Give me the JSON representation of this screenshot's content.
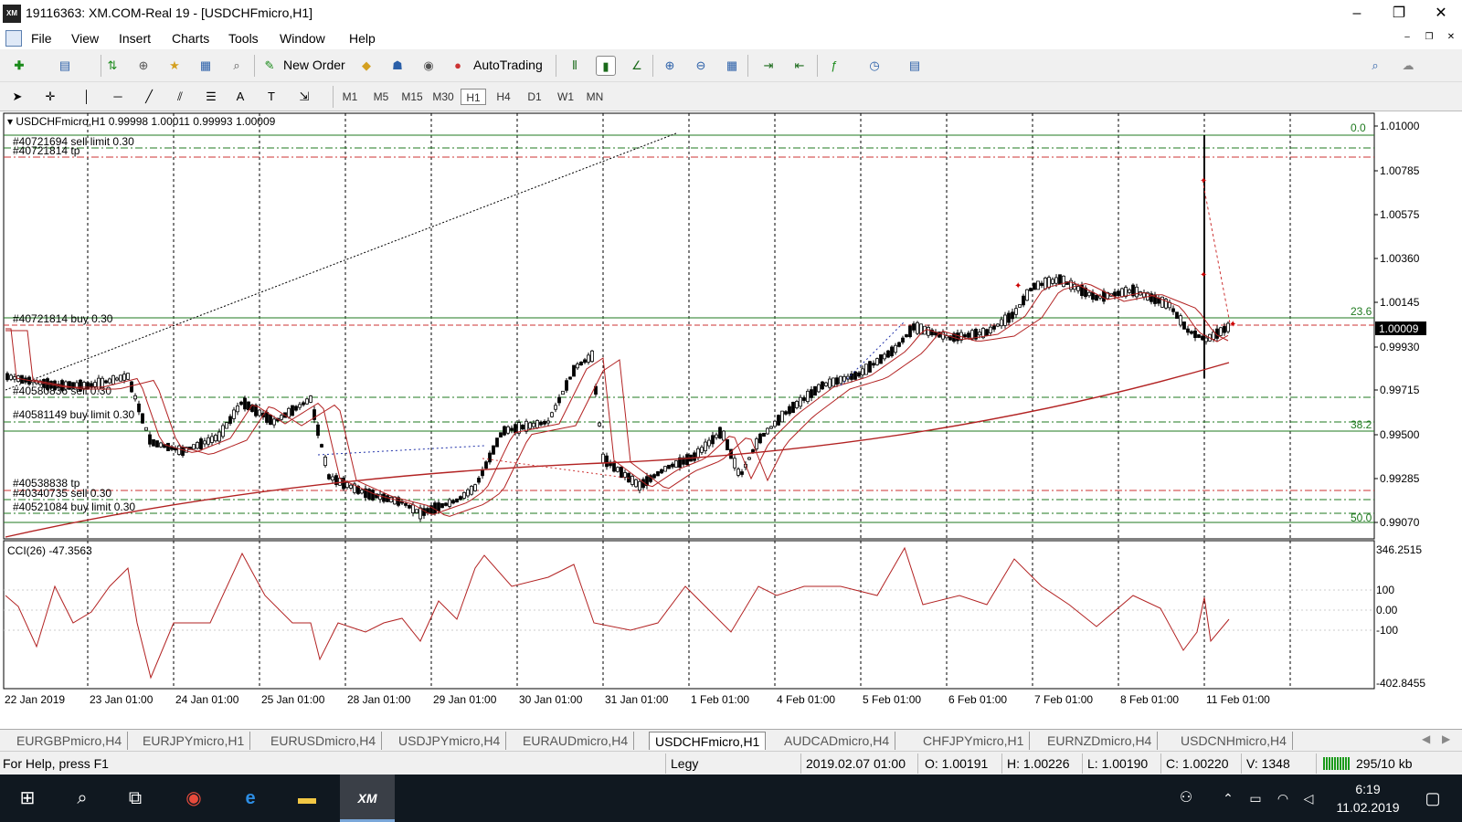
{
  "window": {
    "title": "19116363: XM.COM-Real 19 - [USDCHFmicro,H1]",
    "app_icon_text": "XM",
    "buttons": [
      "–",
      "❐",
      "✕"
    ]
  },
  "menu": [
    "File",
    "View",
    "Insert",
    "Charts",
    "Tools",
    "Window",
    "Help"
  ],
  "mdi_buttons": [
    "–",
    "❐",
    "✕"
  ],
  "toolbar": {
    "new_order": "New Order",
    "autotrading": "AutoTrading"
  },
  "timeframes": [
    "M1",
    "M5",
    "M15",
    "M30",
    "H1",
    "H4",
    "D1",
    "W1",
    "MN"
  ],
  "active_timeframe": "H1",
  "chart": {
    "header": "USDCHFmicro,H1  0.99998 1.00011 0.99993 1.00009",
    "indicator_label": "CCI(26) -47.3563",
    "current_price": "1.00009",
    "price_ticks": [
      "1.01000",
      "1.00785",
      "1.00575",
      "1.00360",
      "1.00145",
      "0.99930",
      "0.99715",
      "0.99500",
      "0.99285",
      "0.99070"
    ],
    "cci_ticks": [
      "346.2515",
      "100",
      "0.00",
      "-100",
      "-402.8455"
    ],
    "time_labels": [
      "22 Jan 2019",
      "23 Jan 01:00",
      "24 Jan 01:00",
      "25 Jan 01:00",
      "28 Jan 01:00",
      "29 Jan 01:00",
      "30 Jan 01:00",
      "31 Jan 01:00",
      "1 Feb 01:00",
      "4 Feb 01:00",
      "5 Feb 01:00",
      "6 Feb 01:00",
      "7 Feb 01:00",
      "8 Feb 01:00",
      "11 Feb 01:00"
    ],
    "order_labels": [
      "#40721694 sell limit 0.30",
      "#40721814 tp",
      "#40721814 buy 0.30",
      "#40580836 sell 0.30",
      "#40581149 buy limit 0.30",
      "#40538838 tp",
      "#40340735 sell 0.30",
      "#40521084 buy limit 0.30"
    ],
    "fib_labels": [
      "0.0",
      "23.6",
      "38.2",
      "50.0"
    ],
    "colors": {
      "candle": "#000000",
      "ma": "#b22222",
      "hline_green": "#1f7a1f",
      "hline_red": "#cc3333",
      "price_box": "#000000"
    }
  },
  "symbol_tabs": [
    "EURGBPmicro,H4",
    "EURJPYmicro,H1",
    "EURUSDmicro,H4",
    "USDJPYmicro,H4",
    "EURAUDmicro,H4",
    "USDCHFmicro,H1",
    "AUDCADmicro,H4",
    "CHFJPYmicro,H1",
    "EURNZDmicro,H4",
    "USDCNHmicro,H4"
  ],
  "active_tab": "USDCHFmicro,H1",
  "status": {
    "help": "For Help, press F1",
    "profile": "Legy",
    "datetime": "2019.02.07 01:00",
    "open": "O: 1.00191",
    "high": "H: 1.00226",
    "low": "L: 1.00190",
    "close": "C: 1.00220",
    "volume": "V: 1348",
    "traffic": "295/10 kb"
  },
  "taskbar": {
    "time": "6:19",
    "date": "11.02.2019",
    "xm_label": "XM"
  }
}
